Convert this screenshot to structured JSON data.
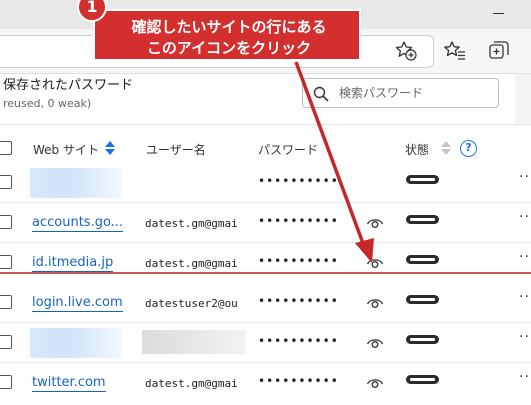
{
  "callout": {
    "badge": "1",
    "line1": "確認したいサイトの行にある",
    "line2": "このアイコンをクリック",
    "color": "#d32f2f"
  },
  "toolbar": {
    "icons": [
      "favorites-add-icon",
      "favorites-icon",
      "collections-icon"
    ]
  },
  "passwords": {
    "title": "保存されたパスワード",
    "subtitle": "reused, 0 weak)",
    "search_placeholder": "検索パスワード"
  },
  "table": {
    "headers": {
      "site": "Web サイト",
      "username": "ユーザー名",
      "password": "パスワード",
      "status": "状態",
      "help": "?"
    },
    "rows": [
      {
        "site": "",
        "site_blurred": true,
        "username": "",
        "user_blurred": false,
        "password": "••••••••••",
        "has_eye": false
      },
      {
        "site": "accounts.go...",
        "site_blurred": false,
        "username": "datest.gm@gmai",
        "user_blurred": false,
        "password": "••••••••••",
        "has_eye": true
      },
      {
        "site": "id.itmedia.jp",
        "site_blurred": false,
        "username": "datest.gm@gmai",
        "user_blurred": false,
        "password": "••••••••••",
        "has_eye": true
      },
      {
        "site": "login.live.com",
        "site_blurred": false,
        "username": "datestuser2@ou",
        "user_blurred": false,
        "password": "••••••••••",
        "has_eye": true
      },
      {
        "site": "",
        "site_blurred": true,
        "username": "",
        "user_blurred": true,
        "password": "••••••••••",
        "has_eye": true
      },
      {
        "site": "twitter.com",
        "site_blurred": false,
        "username": "datest.gm@gmai",
        "user_blurred": false,
        "password": "••••••••••",
        "has_eye": true
      }
    ],
    "more_label": "···"
  },
  "colors": {
    "link": "#1565c0",
    "annotation": "#d32f2f",
    "accent": "#1a73e8"
  }
}
